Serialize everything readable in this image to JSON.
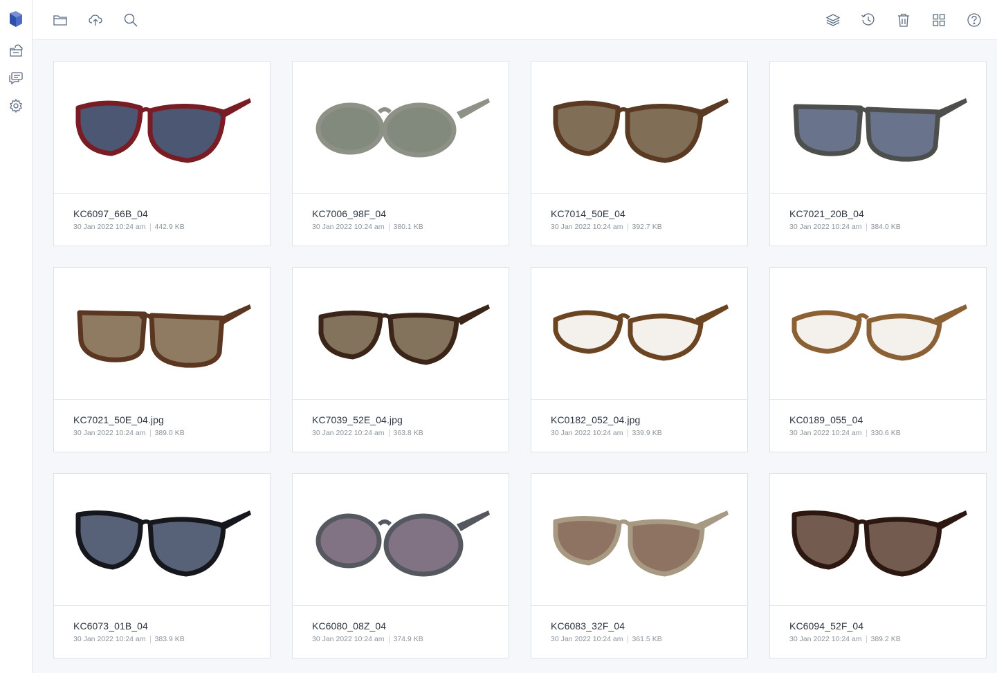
{
  "sidebar": {
    "icons": [
      "logo-icon",
      "cloud-folder-icon",
      "chat-icon",
      "gear-icon"
    ]
  },
  "toolbar": {
    "left_icons": [
      "folder-icon",
      "cloud-upload-icon",
      "search-icon"
    ],
    "right_icons": [
      "layers-icon",
      "history-icon",
      "trash-icon",
      "grid-view-icon",
      "help-icon"
    ]
  },
  "files": [
    {
      "name": "KC6097_66B_04",
      "date": "30 Jan 2022 10:24 am",
      "size": "442.9 KB",
      "frame": "#7a1c24",
      "lens": "#2d3a5c",
      "style": "wrap"
    },
    {
      "name": "KC7006_98F_04",
      "date": "30 Jan 2022 10:24 am",
      "size": "380.1 KB",
      "frame": "#8d9186",
      "lens": "#6c7466",
      "style": "oval"
    },
    {
      "name": "KC7014_50E_04",
      "date": "30 Jan 2022 10:24 am",
      "size": "392.7 KB",
      "frame": "#5a3a22",
      "lens": "#6a5538",
      "style": "wrap"
    },
    {
      "name": "KC7021_20B_04",
      "date": "30 Jan 2022 10:24 am",
      "size": "384.0 KB",
      "frame": "#4d4f4c",
      "lens": "#4f5c78",
      "style": "square"
    },
    {
      "name": "KC7021_50E_04.jpg",
      "date": "30 Jan 2022 10:24 am",
      "size": "389.0 KB",
      "frame": "#5b3620",
      "lens": "#7a6446",
      "style": "square"
    },
    {
      "name": "KC7039_52E_04.jpg",
      "date": "30 Jan 2022 10:24 am",
      "size": "363.8 KB",
      "frame": "#3b2418",
      "lens": "#6e5a40",
      "style": "clubmaster"
    },
    {
      "name": "KC0182_052_04.jpg",
      "date": "30 Jan 2022 10:24 am",
      "size": "339.9 KB",
      "frame": "#6b4422",
      "lens": "#f4f1ec",
      "style": "optical"
    },
    {
      "name": "KC0189_055_04",
      "date": "30 Jan 2022 10:24 am",
      "size": "330.6 KB",
      "frame": "#8a6034",
      "lens": "#f4f1ec",
      "style": "optical"
    },
    {
      "name": "KC6073_01B_04",
      "date": "30 Jan 2022 10:24 am",
      "size": "383.9 KB",
      "frame": "#15171d",
      "lens": "#3a4560",
      "style": "cat"
    },
    {
      "name": "KC6080_08Z_04",
      "date": "30 Jan 2022 10:24 am",
      "size": "374.9 KB",
      "frame": "#55585e",
      "lens": "#6b5a6e",
      "style": "metal"
    },
    {
      "name": "KC6083_32F_04",
      "date": "30 Jan 2022 10:24 am",
      "size": "361.5 KB",
      "frame": "#a89a82",
      "lens": "#7a5a46",
      "style": "aviator"
    },
    {
      "name": "KC6094_52F_04",
      "date": "30 Jan 2022 10:24 am",
      "size": "389.2 KB",
      "frame": "#2c1810",
      "lens": "#5a4030",
      "style": "cat"
    }
  ]
}
